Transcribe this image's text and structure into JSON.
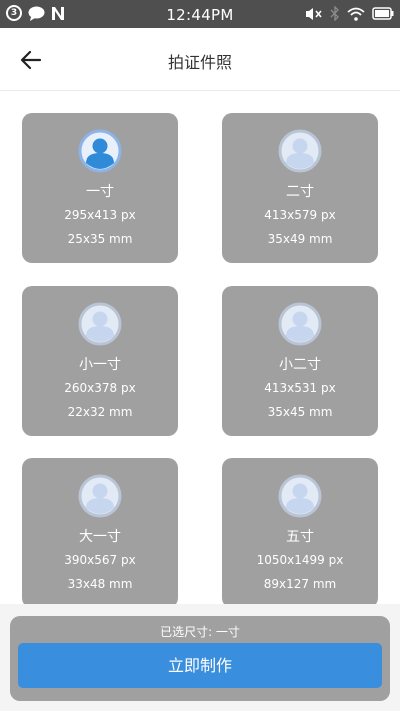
{
  "status_bar": {
    "notification_count": "3",
    "time": "12:44PM",
    "icons": [
      "notification-badge-icon",
      "chat-bubble-icon",
      "n-app-icon",
      "mute-icon",
      "bluetooth-icon",
      "wifi-icon",
      "battery-icon"
    ]
  },
  "header": {
    "back_icon": "arrow-left-icon",
    "title": "拍证件照"
  },
  "sizes": [
    {
      "name": "一寸",
      "px": "295x413 px",
      "mm": "25x35 mm",
      "selected": true
    },
    {
      "name": "二寸",
      "px": "413x579 px",
      "mm": "35x49 mm",
      "selected": false
    },
    {
      "name": "小一寸",
      "px": "260x378 px",
      "mm": "22x32 mm",
      "selected": false
    },
    {
      "name": "小二寸",
      "px": "413x531 px",
      "mm": "35x45 mm",
      "selected": false
    },
    {
      "name": "大一寸",
      "px": "390x567 px",
      "mm": "33x48 mm",
      "selected": false
    },
    {
      "name": "五寸",
      "px": "1050x1499 px",
      "mm": "89x127 mm",
      "selected": false
    }
  ],
  "bottom": {
    "selected_text": "已选尺寸: 一寸",
    "make_button": "立即制作"
  },
  "colors": {
    "status_bar": "#4f4f4f",
    "card_bg": "#a0a0a0",
    "primary_button": "#3a8ede",
    "avatar_selected": "#2f8ad8",
    "avatar_default": "#c7d6ef"
  }
}
